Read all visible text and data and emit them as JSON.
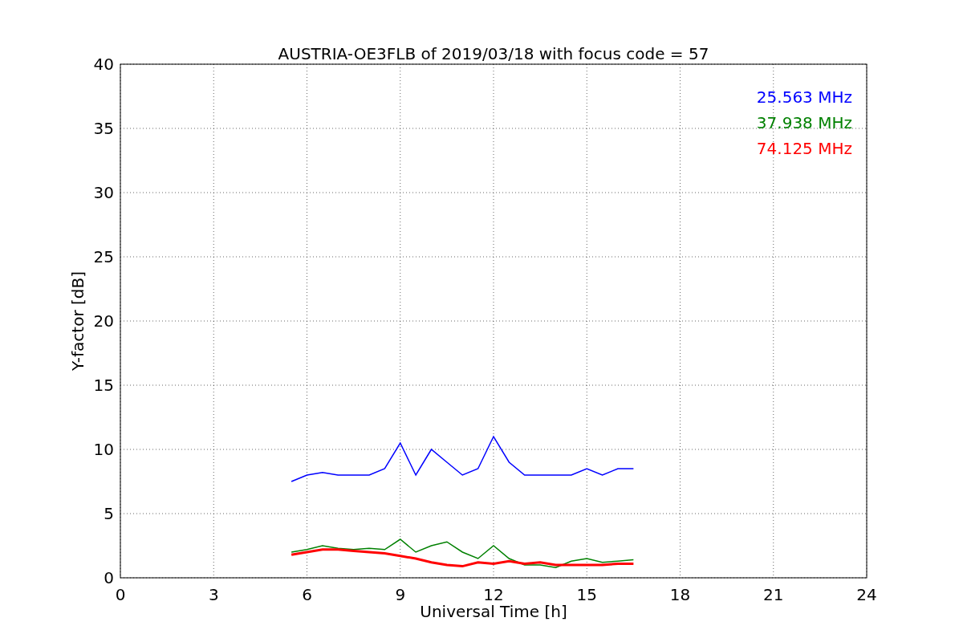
{
  "chart": {
    "chart_data": {
      "type": "line",
      "title": "AUSTRIA-OE3FLB of 2019/03/18 with focus code = 57",
      "xlabel": "Universal Time [h]",
      "ylabel": "Y-factor [dB]",
      "x": [
        5.5,
        6,
        6.5,
        7,
        7.5,
        8,
        8.5,
        9,
        9.5,
        10,
        10.5,
        11,
        11.5,
        12,
        12.5,
        13,
        13.5,
        14,
        14.5,
        15,
        15.5,
        16,
        16.5
      ],
      "series": [
        {
          "name": "25.563 MHz",
          "color": "#0000ff",
          "values": [
            7.5,
            8,
            8.2,
            8,
            8,
            8,
            8.5,
            10.5,
            8,
            10,
            9,
            8,
            8.5,
            11,
            9,
            8,
            8,
            8,
            8,
            8.5,
            8,
            8.5,
            8.5
          ]
        },
        {
          "name": "37.938 MHz",
          "color": "#008000",
          "values": [
            2,
            2.2,
            2.5,
            2.3,
            2.2,
            2.3,
            2.2,
            3,
            2,
            2.5,
            2.8,
            2,
            1.5,
            2.5,
            1.5,
            1,
            1,
            0.8,
            1.3,
            1.5,
            1.2,
            1.3,
            1.4
          ]
        },
        {
          "name": "74.125 MHz",
          "color": "#ff0000",
          "values": [
            1.8,
            2,
            2.2,
            2.2,
            2.1,
            2,
            1.9,
            1.7,
            1.5,
            1.2,
            1,
            0.9,
            1.2,
            1.1,
            1.3,
            1.1,
            1.2,
            1,
            1,
            1,
            1,
            1.1,
            1.1
          ]
        }
      ],
      "grid": true,
      "xlim": [
        0,
        24
      ],
      "ylim": [
        0,
        40
      ],
      "xticks": [
        0,
        3,
        6,
        9,
        12,
        15,
        18,
        21,
        24
      ],
      "yticks": [
        0,
        5,
        10,
        15,
        20,
        25,
        30,
        35,
        40
      ]
    }
  }
}
